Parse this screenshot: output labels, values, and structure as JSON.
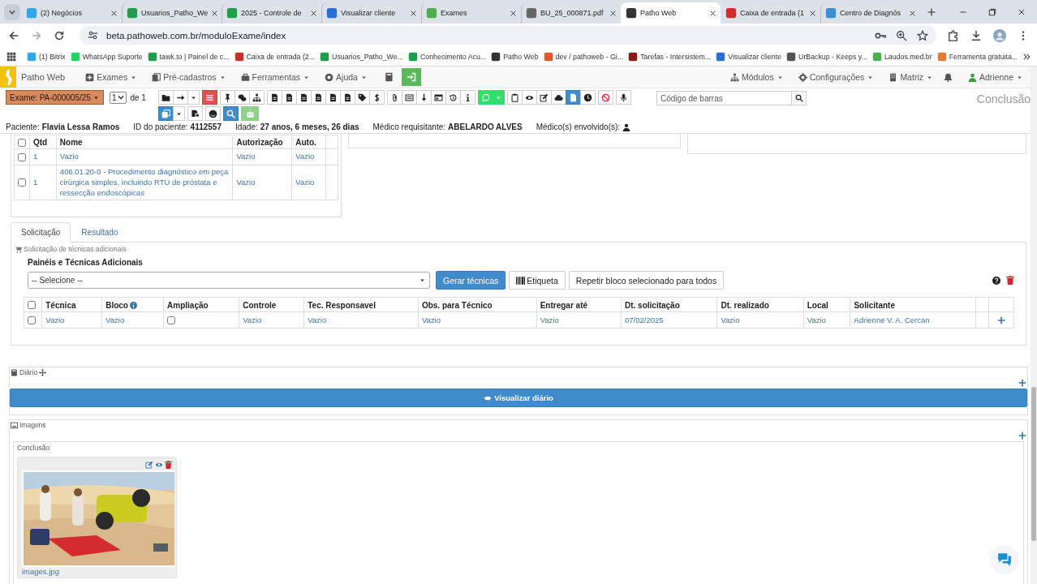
{
  "browser": {
    "tabs": [
      {
        "title": "(2) Negócios",
        "selected": false
      },
      {
        "title": "Usuarios_Patho_We",
        "selected": false
      },
      {
        "title": "2025 - Controle de",
        "selected": false
      },
      {
        "title": "Visualizar cliente",
        "selected": false
      },
      {
        "title": "Exames",
        "selected": false
      },
      {
        "title": "BU_25_000871.pdf",
        "selected": false
      },
      {
        "title": "Patho Web",
        "selected": true
      },
      {
        "title": "Caixa de entrada (1",
        "selected": false
      },
      {
        "title": "Centro de Diagnós",
        "selected": false
      }
    ],
    "url": "beta.pathoweb.com.br/moduloExame/index",
    "bookmarks": [
      "(1) Bitrix",
      "WhatsApp Suporte",
      "tawk.to | Painel de c...",
      "Caixa de entrada (2...",
      "Usuarios_Patho_We...",
      "Conhecimento Acu...",
      "Patho Web",
      "dev / pathoweb - Gi...",
      "Tarefas - Intersistem...",
      "Visualizar cliente",
      "UrBackup - Keeps y...",
      "Laudos.med.br",
      "Ferramenta gratuita..."
    ]
  },
  "navbar": {
    "brand": "Patho Web",
    "menus": [
      "Exames",
      "Pré-cadastros",
      "Ferramentas",
      "Ajuda"
    ],
    "right_menus": [
      "Módulos",
      "Configurações",
      "Matriz"
    ],
    "user": "Adrienne"
  },
  "exam_bar": {
    "exam": "Exame: PA-000005/25",
    "page": "1",
    "page_total": "de 1",
    "toolbar": [
      [
        [
          {
            "kind": "default"
          },
          {
            "kind": "default"
          },
          {
            "kind": "default"
          }
        ],
        [
          {
            "kind": "danger"
          }
        ],
        [
          {
            "kind": "default"
          },
          {
            "kind": "default"
          },
          {
            "kind": "default"
          }
        ],
        [
          {
            "kind": "default"
          },
          {
            "kind": "default"
          },
          {
            "kind": "default"
          },
          {
            "kind": "default"
          },
          {
            "kind": "default"
          },
          {
            "kind": "default"
          },
          {
            "kind": "default"
          },
          {
            "kind": "default"
          }
        ],
        [
          {
            "kind": "default"
          },
          {
            "kind": "default"
          },
          {
            "kind": "default"
          },
          {
            "kind": "default"
          },
          {
            "kind": "default"
          },
          {
            "kind": "default"
          }
        ],
        [
          {
            "kind": "success"
          },
          {
            "kind": "success"
          }
        ],
        [
          {
            "kind": "default"
          },
          {
            "kind": "default"
          },
          {
            "kind": "default"
          },
          {
            "kind": "default"
          },
          {
            "kind": "primary"
          },
          {
            "kind": "default"
          }
        ],
        [
          {
            "kind": "default"
          }
        ],
        [
          {
            "kind": "default"
          }
        ]
      ],
      [
        [
          {
            "kind": "primary"
          },
          {
            "kind": "default"
          }
        ],
        [
          {
            "kind": "default"
          }
        ],
        [
          {
            "kind": "default"
          }
        ],
        [
          {
            "kind": "primary"
          }
        ],
        [
          {
            "kind": "light-success"
          }
        ]
      ]
    ],
    "barcode": {
      "placeholder": "Código de barras"
    },
    "title": "Conclusão"
  },
  "patient": [
    {
      "kind": "text",
      "label": "Paciente:",
      "value": "Flavia Lessa Ramos"
    },
    {
      "kind": "text",
      "label": "ID do paciente:",
      "value": "4112557"
    },
    {
      "kind": "text",
      "label": "Idade:",
      "value": "27 anos, 6 meses, 26 dias"
    },
    {
      "kind": "text",
      "label": "Médico requisitante:",
      "value": "ABELARDO ALVES"
    },
    {
      "kind": "icon",
      "label": "Médico(s) envolvido(s):"
    }
  ],
  "procedures": {
    "all_checked": false,
    "columns": [
      "Qtd",
      "Nome",
      "Autorização",
      "Auto."
    ],
    "rows": [
      {
        "checked": false,
        "cells": [
          "1",
          "Vazio",
          "Vazio",
          "Vazio"
        ]
      },
      {
        "checked": false,
        "cells": [
          "1",
          "406.01.20-0 - Procedimento diagnóstico em peça cirúrgica simples, incluindo RTU de próstata e ressecção endoscópicas",
          "Vazio",
          "Vazio"
        ]
      }
    ]
  },
  "tabs": [
    {
      "label": "Solicitação",
      "selected": true
    },
    {
      "label": "Resultado",
      "selected": false
    }
  ],
  "techniques": {
    "title": "Solicitação de técnicas adicionais",
    "panel_label": "Painéis e Técnicas Adicionais",
    "select": "-- Selecione --",
    "buttons": [
      {
        "kind": "primary",
        "label": "Gerar técnicas"
      },
      {
        "kind": "barcode",
        "label": "Etiqueta"
      },
      {
        "kind": "default",
        "label": "Repetir bloco selecionado para todos"
      }
    ],
    "all_checked": false,
    "columns": [
      {
        "label": "Técnica"
      },
      {
        "label": "Bloco",
        "info": true
      },
      {
        "label": "Ampliação"
      },
      {
        "label": "Controle"
      },
      {
        "label": "Tec. Responsavel"
      },
      {
        "label": "Obs. para Técnico"
      },
      {
        "label": "Entregar até"
      },
      {
        "label": "Dt. solicitação"
      },
      {
        "label": "Dt. realizado"
      },
      {
        "label": "Local"
      },
      {
        "label": "Solicitante"
      }
    ],
    "rows": [
      {
        "checked": false,
        "cells": [
          {
            "kind": "text",
            "text": "Vazio"
          },
          {
            "kind": "text",
            "text": "Vazio"
          },
          {
            "kind": "checkbox",
            "checked": false
          },
          {
            "kind": "text",
            "text": "Vazio"
          },
          {
            "kind": "text",
            "text": "Vazio"
          },
          {
            "kind": "text",
            "text": "Vazio"
          },
          {
            "kind": "text",
            "text": "Vazio"
          },
          {
            "kind": "text",
            "text": "07/02/2025"
          },
          {
            "kind": "text",
            "text": "Vazio"
          },
          {
            "kind": "text",
            "text": "Vazio"
          },
          {
            "kind": "text",
            "text": "Adrienne V. A. Cercan"
          }
        ]
      }
    ]
  },
  "diary": {
    "title": "Diário",
    "button": "Visualizar diário"
  },
  "images": {
    "title": "Imagens",
    "section": "Conclusão",
    "items": [
      {
        "kind": "picture",
        "filename": "images.jpg"
      }
    ]
  }
}
